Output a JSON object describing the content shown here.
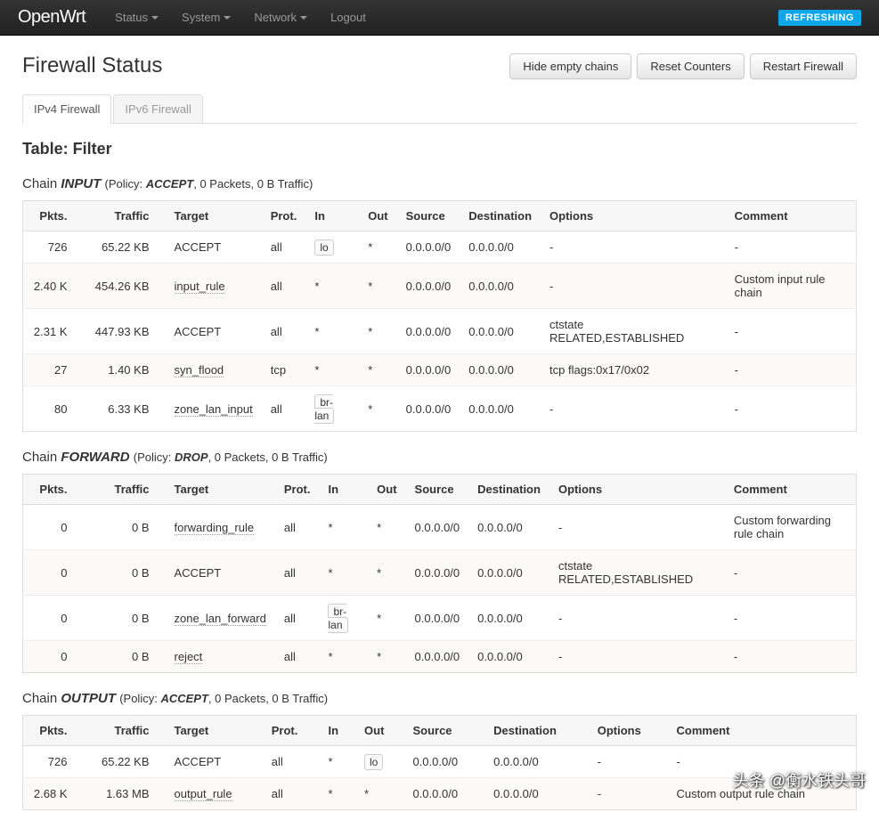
{
  "navbar": {
    "brand": "OpenWrt",
    "menu": [
      "Status",
      "System",
      "Network",
      "Logout"
    ],
    "badge": "REFRESHING"
  },
  "page": {
    "title": "Firewall Status",
    "buttons": {
      "hide": "Hide empty chains",
      "reset": "Reset Counters",
      "restart": "Restart Firewall"
    },
    "tabs": {
      "ipv4": "IPv4 Firewall",
      "ipv6": "IPv6 Firewall"
    }
  },
  "table_label_prefix": "Table: ",
  "table_name": "Filter",
  "chain_label": "Chain ",
  "headers": {
    "pkts": "Pkts.",
    "traffic": "Traffic",
    "target": "Target",
    "prot": "Prot.",
    "in": "In",
    "out": "Out",
    "source": "Source",
    "dest": "Destination",
    "options": "Options",
    "comment": "Comment"
  },
  "chains": [
    {
      "name": "INPUT",
      "policy_html": "(Policy: <em>ACCEPT</em>, 0 Packets, 0 B Traffic)",
      "rows": [
        {
          "pkts": "726",
          "traffic": "65.22 KB",
          "target": "ACCEPT",
          "target_link": false,
          "prot": "all",
          "in": "lo",
          "in_badge": true,
          "out": "*",
          "source": "0.0.0.0/0",
          "dest": "0.0.0.0/0",
          "options": "-",
          "comment": "-"
        },
        {
          "pkts": "2.40 K",
          "traffic": "454.26 KB",
          "target": "input_rule",
          "target_link": true,
          "prot": "all",
          "in": "*",
          "in_badge": false,
          "out": "*",
          "source": "0.0.0.0/0",
          "dest": "0.0.0.0/0",
          "options": "-",
          "comment": "Custom input rule chain"
        },
        {
          "pkts": "2.31 K",
          "traffic": "447.93 KB",
          "target": "ACCEPT",
          "target_link": false,
          "prot": "all",
          "in": "*",
          "in_badge": false,
          "out": "*",
          "source": "0.0.0.0/0",
          "dest": "0.0.0.0/0",
          "options": "ctstate RELATED,ESTABLISHED",
          "comment": "-"
        },
        {
          "pkts": "27",
          "traffic": "1.40 KB",
          "target": "syn_flood",
          "target_link": true,
          "prot": "tcp",
          "in": "*",
          "in_badge": false,
          "out": "*",
          "source": "0.0.0.0/0",
          "dest": "0.0.0.0/0",
          "options": "tcp flags:0x17/0x02",
          "comment": "-"
        },
        {
          "pkts": "80",
          "traffic": "6.33 KB",
          "target": "zone_lan_input",
          "target_link": true,
          "prot": "all",
          "in": "br-lan",
          "in_badge": true,
          "out": "*",
          "source": "0.0.0.0/0",
          "dest": "0.0.0.0/0",
          "options": "-",
          "comment": "-"
        }
      ]
    },
    {
      "name": "FORWARD",
      "policy_html": "(Policy: <em>DROP</em>, 0 Packets, 0 B Traffic)",
      "rows": [
        {
          "pkts": "0",
          "traffic": "0 B",
          "target": "forwarding_rule",
          "target_link": true,
          "prot": "all",
          "in": "*",
          "in_badge": false,
          "out": "*",
          "source": "0.0.0.0/0",
          "dest": "0.0.0.0/0",
          "options": "-",
          "comment": "Custom forwarding rule chain"
        },
        {
          "pkts": "0",
          "traffic": "0 B",
          "target": "ACCEPT",
          "target_link": false,
          "prot": "all",
          "in": "*",
          "in_badge": false,
          "out": "*",
          "source": "0.0.0.0/0",
          "dest": "0.0.0.0/0",
          "options": "ctstate RELATED,ESTABLISHED",
          "comment": "-"
        },
        {
          "pkts": "0",
          "traffic": "0 B",
          "target": "zone_lan_forward",
          "target_link": true,
          "prot": "all",
          "in": "br-lan",
          "in_badge": true,
          "out": "*",
          "source": "0.0.0.0/0",
          "dest": "0.0.0.0/0",
          "options": "-",
          "comment": "-"
        },
        {
          "pkts": "0",
          "traffic": "0 B",
          "target": "reject",
          "target_link": true,
          "prot": "all",
          "in": "*",
          "in_badge": false,
          "out": "*",
          "source": "0.0.0.0/0",
          "dest": "0.0.0.0/0",
          "options": "-",
          "comment": "-"
        }
      ]
    },
    {
      "name": "OUTPUT",
      "policy_html": "(Policy: <em>ACCEPT</em>, 0 Packets, 0 B Traffic)",
      "rows": [
        {
          "pkts": "726",
          "traffic": "65.22 KB",
          "target": "ACCEPT",
          "target_link": false,
          "prot": "all",
          "in": "*",
          "in_badge": false,
          "out": "lo",
          "out_badge": true,
          "source": "0.0.0.0/0",
          "dest": "0.0.0.0/0",
          "options": "-",
          "comment": "-"
        },
        {
          "pkts": "2.68 K",
          "traffic": "1.63 MB",
          "target": "output_rule",
          "target_link": true,
          "prot": "all",
          "in": "*",
          "in_badge": false,
          "out": "*",
          "out_badge": false,
          "source": "0.0.0.0/0",
          "dest": "0.0.0.0/0",
          "options": "-",
          "comment": "Custom output rule chain"
        }
      ]
    }
  ],
  "watermark": "头条 @衡水铁头哥"
}
